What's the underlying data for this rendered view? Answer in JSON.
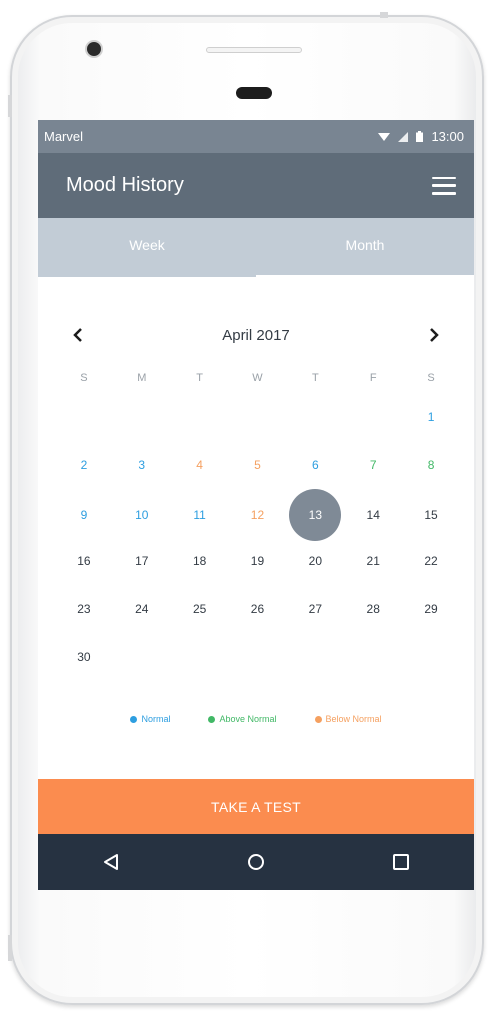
{
  "status_bar": {
    "carrier": "Marvel",
    "time": "13:00",
    "icons": [
      "wifi-icon",
      "signal-icon",
      "battery-icon"
    ]
  },
  "app_bar": {
    "title": "Mood History",
    "menu_icon": "hamburger-menu-icon"
  },
  "tabs": [
    {
      "label": "Week",
      "active": false
    },
    {
      "label": "Month",
      "active": true
    }
  ],
  "calendar": {
    "month_label": "April 2017",
    "prev_icon": "chevron-left-icon",
    "next_icon": "chevron-right-icon",
    "weekdays": [
      "S",
      "M",
      "T",
      "W",
      "T",
      "F",
      "S"
    ],
    "weeks": [
      [
        null,
        null,
        null,
        null,
        null,
        null,
        {
          "day": "1",
          "mood": "normal"
        }
      ],
      [
        {
          "day": "2",
          "mood": "normal"
        },
        {
          "day": "3",
          "mood": "normal"
        },
        {
          "day": "4",
          "mood": "below"
        },
        {
          "day": "5",
          "mood": "below"
        },
        {
          "day": "6",
          "mood": "normal"
        },
        {
          "day": "7",
          "mood": "above"
        },
        {
          "day": "8",
          "mood": "above"
        }
      ],
      [
        {
          "day": "9",
          "mood": "normal"
        },
        {
          "day": "10",
          "mood": "normal"
        },
        {
          "day": "11",
          "mood": "normal"
        },
        {
          "day": "12",
          "mood": "below"
        },
        {
          "day": "13",
          "mood": "selected"
        },
        {
          "day": "14",
          "mood": "none"
        },
        {
          "day": "15",
          "mood": "none"
        }
      ],
      [
        {
          "day": "16",
          "mood": "none"
        },
        {
          "day": "17",
          "mood": "none"
        },
        {
          "day": "18",
          "mood": "none"
        },
        {
          "day": "19",
          "mood": "none"
        },
        {
          "day": "20",
          "mood": "none"
        },
        {
          "day": "21",
          "mood": "none"
        },
        {
          "day": "22",
          "mood": "none"
        }
      ],
      [
        {
          "day": "23",
          "mood": "none"
        },
        {
          "day": "24",
          "mood": "none"
        },
        {
          "day": "25",
          "mood": "none"
        },
        {
          "day": "26",
          "mood": "none"
        },
        {
          "day": "27",
          "mood": "none"
        },
        {
          "day": "28",
          "mood": "none"
        },
        {
          "day": "29",
          "mood": "none"
        }
      ],
      [
        {
          "day": "30",
          "mood": "none"
        },
        null,
        null,
        null,
        null,
        null,
        null
      ]
    ]
  },
  "legend": [
    {
      "label": "Normal",
      "color": "#2d9ee0",
      "key": "normal"
    },
    {
      "label": "Above Normal",
      "color": "#41b866",
      "key": "above"
    },
    {
      "label": "Below Normal",
      "color": "#f5a060",
      "key": "below"
    }
  ],
  "cta": {
    "label": "TAKE A TEST",
    "color": "#fb8c4f"
  },
  "system_nav": {
    "buttons": [
      "back-icon",
      "home-icon",
      "recents-icon"
    ]
  },
  "colors": {
    "status_bar": "#798592",
    "app_bar": "#5f6c79",
    "tabs": "#c2ccd6",
    "selected_day": "#7f8a96",
    "nav_bar": "#263241"
  }
}
